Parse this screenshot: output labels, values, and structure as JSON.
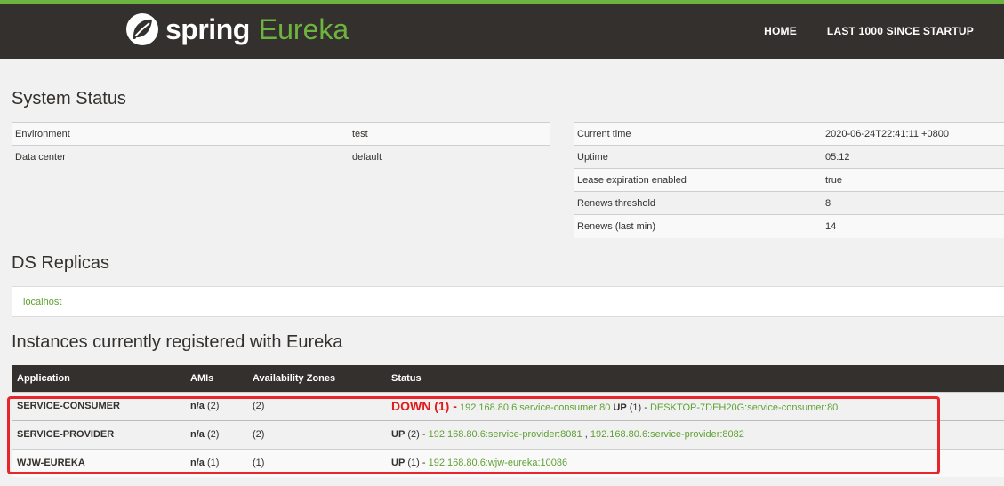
{
  "header": {
    "brand_spring": "spring",
    "brand_eureka": "Eureka",
    "nav": [
      {
        "label": "HOME"
      },
      {
        "label": "LAST 1000 SINCE STARTUP"
      }
    ]
  },
  "system_status": {
    "title": "System Status",
    "left": [
      {
        "key": "Environment",
        "value": "test"
      },
      {
        "key": "Data center",
        "value": "default"
      }
    ],
    "right": [
      {
        "key": "Current time",
        "value": "2020-06-24T22:41:11 +0800"
      },
      {
        "key": "Uptime",
        "value": "05:12"
      },
      {
        "key": "Lease expiration enabled",
        "value": "true"
      },
      {
        "key": "Renews threshold",
        "value": "8"
      },
      {
        "key": "Renews (last min)",
        "value": "14"
      }
    ]
  },
  "ds_replicas": {
    "title": "DS Replicas",
    "items": [
      "localhost"
    ]
  },
  "instances": {
    "title": "Instances currently registered with Eureka",
    "columns": [
      "Application",
      "AMIs",
      "Availability Zones",
      "Status"
    ],
    "rows": [
      {
        "application": "SERVICE-CONSUMER",
        "amis_na": "n/a",
        "amis_count": "(2)",
        "zones": "(2)",
        "status_down": "DOWN (1) -",
        "status_down_link": "192.168.80.6:service-consumer:80",
        "status_up": "UP",
        "status_up_count": "(1) -",
        "status_up_link": "DESKTOP-7DEH20G:service-consumer:80"
      },
      {
        "application": "SERVICE-PROVIDER",
        "amis_na": "n/a",
        "amis_count": "(2)",
        "zones": "(2)",
        "status_up": "UP",
        "status_up_count": "(2) -",
        "status_up_link": "192.168.80.6:service-provider:8081",
        "status_sep": ",",
        "status_up_link2": "192.168.80.6:service-provider:8082"
      },
      {
        "application": "WJW-EUREKA",
        "amis_na": "n/a",
        "amis_count": "(1)",
        "zones": "(1)",
        "status_up": "UP",
        "status_up_count": "(1) -",
        "status_up_link": "192.168.80.6:wjw-eureka:10086"
      }
    ]
  },
  "colors": {
    "header_bg": "#34302d",
    "accent_green": "#6db33f",
    "down_red": "#e01b1b",
    "highlight_box": "#e8252a"
  }
}
